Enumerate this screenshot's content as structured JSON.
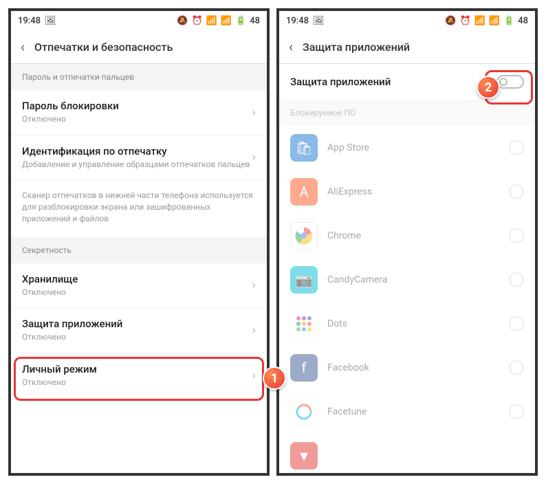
{
  "status": {
    "time": "19:48",
    "battery": "48"
  },
  "left": {
    "header": "Отпечатки и безопасность",
    "section1": "Пароль и отпечатки пальцев",
    "item1": {
      "title": "Пароль блокировки",
      "subtitle": "Отключено"
    },
    "item2": {
      "title": "Идентификация по отпечатку",
      "subtitle": "Добавление и управление образцами отпечатков пальцев"
    },
    "info": "Сканер отпечатков в нижней части телефона используется для разблокировки экрана или зашифрованных приложений и файлов",
    "section2": "Секретность",
    "item3": {
      "title": "Хранилище",
      "subtitle": "Отключено"
    },
    "item4": {
      "title": "Защита приложений",
      "subtitle": "Отключено"
    },
    "item5": {
      "title": "Личный режим",
      "subtitle": "Отключено"
    }
  },
  "right": {
    "header": "Защита приложений",
    "toggle_label": "Защита приложений",
    "section": "Блокируемое ПО",
    "apps": [
      "App Store",
      "AliExpress",
      "Chrome",
      "CandyCamera",
      "Dots",
      "Facebook",
      "Facetune"
    ]
  },
  "badges": {
    "one": "1",
    "two": "2"
  }
}
